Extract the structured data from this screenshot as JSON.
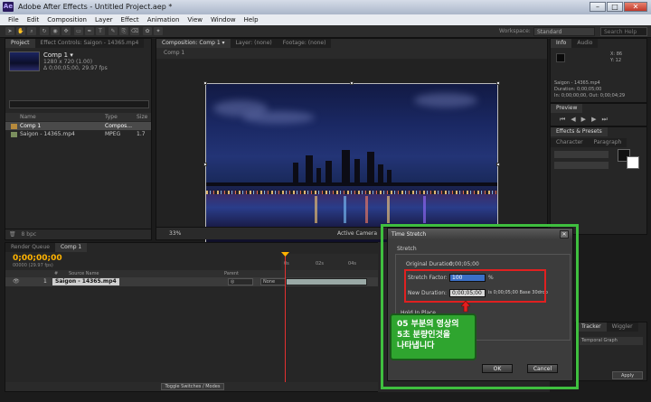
{
  "window": {
    "logo": "Ae",
    "title": "Adobe After Effects - Untitled Project.aep *",
    "min": "–",
    "max": "□",
    "close": "✕"
  },
  "menu": [
    "File",
    "Edit",
    "Composition",
    "Layer",
    "Effect",
    "Animation",
    "View",
    "Window",
    "Help"
  ],
  "toolbar": {
    "workspace_label": "Workspace:",
    "workspace_value": "Standard",
    "search_placeholder": "Search Help"
  },
  "project": {
    "tabs": [
      "Project",
      "Effect Controls: Saigon - 14365.mp4"
    ],
    "comp_name": "Comp 1 ▾",
    "comp_dims": "1280 x 720 (1.00)",
    "comp_duration": "Δ 0;00;05;00, 29.97 fps",
    "columns": [
      "Name",
      "Type",
      "Size"
    ],
    "items": [
      {
        "name": "Comp 1",
        "type": "Compos...",
        "icon": "composition-icon"
      },
      {
        "name": "Saigon - 14365.mp4",
        "type": "MPEG",
        "size": "1.7",
        "icon": "footage-icon"
      }
    ],
    "bpc": "8 bpc"
  },
  "composition": {
    "tabs": [
      "Composition: Comp 1 ▾",
      "Layer: (none)",
      "Footage: (none)"
    ],
    "breadcrumb": "Comp 1",
    "zoom": "33%",
    "camera": "Active Camera"
  },
  "right_panels": {
    "info_tab": "Info",
    "audio_tab": "Audio",
    "info_lines": [
      "X: 86",
      "Y: 12",
      "Saigon - 14365.mp4",
      "Duration: 0;00;05;00",
      "In: 0;00;00;00, Out: 0;00;04;29"
    ],
    "preview_tab": "Preview",
    "effects_tab": "Effects & Presets",
    "char_tab": "Character",
    "paragraph_tab": "Paragraph",
    "tracker_tab": "Tracker",
    "wiggler_tab": "Wiggler",
    "temporal_graph": "Temporal Graph",
    "apply": "Apply"
  },
  "timeline": {
    "tabs": [
      "Render Queue",
      "Comp 1"
    ],
    "timecode": "0;00;00;00",
    "fps_sub": "00000 (29.97 fps)",
    "columns": [
      "#",
      "Source Name",
      "Parent"
    ],
    "layer_index": "1",
    "layer_name": "Saigon - 14365.mp4",
    "mode": "None",
    "ruler": [
      "0s",
      "02s",
      "04s"
    ],
    "toggle_label": "Toggle Switches / Modes"
  },
  "dialog": {
    "title": "Time Stretch",
    "close": "✕",
    "group_label": "Stretch",
    "original_duration_label": "Original Duration:",
    "original_duration": "0;00;05;00",
    "stretch_factor_label": "Stretch Factor:",
    "stretch_factor": "100",
    "stretch_unit": "%",
    "new_duration_label": "New Duration:",
    "new_duration": "0;00;05;00",
    "new_duration_note": "is 0;00;05;00  Base 30drop",
    "hold_label": "Hold In Place",
    "ok": "OK",
    "cancel": "Cancel"
  },
  "annotation": {
    "callout_lines": [
      "05 부분의 영상의",
      "5초 분량인것을",
      "나타냅니다"
    ]
  },
  "colors": {
    "highlight": "#3fbf3f",
    "callout": "#2fa52f",
    "red_box": "#e02020",
    "timecode": "#ffb300"
  }
}
